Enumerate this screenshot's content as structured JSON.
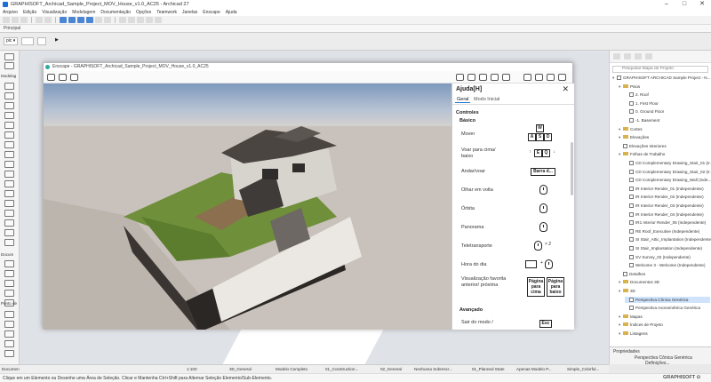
{
  "window": {
    "title": "GRAPHISOFT_Archicad_Sample_Project_MOV_House_v1.0_AC25 - Archicad 27",
    "minimize": "–",
    "maximize": "□",
    "close": "✕"
  },
  "menubar": [
    "Arquivo",
    "Edição",
    "Visualização",
    "Modelagem",
    "Documentação",
    "Opções",
    "Teamwork",
    "Janelas",
    "Enscape",
    "Ajuda"
  ],
  "toolbar": {
    "tab_label": "Principal"
  },
  "infobox": {
    "selector": "pic ▾",
    "arrow": "▶"
  },
  "toolbox": {
    "label_top": "Modelag",
    "label_mid": "Docum",
    "label_bot": "Ponto de"
  },
  "enscape": {
    "title": "Enscape - GRAPHISOFT_Archicad_Sample_Project_MOV_House_v1.0_AC25",
    "help": {
      "title": "Ajuda[H]",
      "close": "✕",
      "tabs": [
        "Geral",
        "Modo Inicial"
      ],
      "section_controls": "Controles",
      "section_basic": "Básico",
      "rows": [
        {
          "label": "Mover",
          "keys": [
            "W",
            "A",
            "S",
            "D"
          ]
        },
        {
          "label": "Voar para cima/ baixo",
          "keys": [
            "↑",
            "E",
            "Q",
            "↓"
          ]
        },
        {
          "label": "Andar/voar",
          "keys": [
            "Barra d..."
          ]
        },
        {
          "label": "Olhar em volta"
        },
        {
          "label": "Órbita"
        },
        {
          "label": "Panorama"
        },
        {
          "label": "Teletransporte",
          "suffix": "× 2"
        },
        {
          "label": "Hora do dia",
          "suffix": "+"
        },
        {
          "label": "Visualização favorita anterior/ próxima",
          "keys": [
            "Página para cima",
            "Página para baixo"
          ]
        }
      ],
      "section_advanced": "Avançado",
      "advanced_row": {
        "label": "Sair do modo /",
        "key": "Esc"
      }
    }
  },
  "navigator": {
    "search_placeholder": "Pesquisar Mapa de Projeto",
    "tree": [
      {
        "label": "GRAPHISOFT ARCHICAD Sample Project - N...",
        "level": 0,
        "type": "root"
      },
      {
        "label": "Pisos",
        "level": 1,
        "type": "folder"
      },
      {
        "label": "2. Roof",
        "level": 2,
        "type": "item"
      },
      {
        "label": "1. First Floor",
        "level": 2,
        "type": "item"
      },
      {
        "label": "0. Ground Floor",
        "level": 2,
        "type": "item"
      },
      {
        "label": "-1. Basement",
        "level": 2,
        "type": "item"
      },
      {
        "label": "Cortes",
        "level": 1,
        "type": "folder"
      },
      {
        "label": "Elevações",
        "level": 1,
        "type": "folder"
      },
      {
        "label": "Elevações Interiores",
        "level": 1,
        "type": "item"
      },
      {
        "label": "Folhas de Trabalho",
        "level": 1,
        "type": "folder"
      },
      {
        "label": "CD Complementary Drawing_Stair_01 (Ir...",
        "level": 2,
        "type": "item"
      },
      {
        "label": "CD Complementary Drawing_Stair_02 (Ir...",
        "level": 2,
        "type": "item"
      },
      {
        "label": "CD Complementary Drawing_Wall (Inde...",
        "level": 2,
        "type": "item"
      },
      {
        "label": "IR Interior Render_01 (Independente)",
        "level": 2,
        "type": "item"
      },
      {
        "label": "IR Interior Render_02 (Independente)",
        "level": 2,
        "type": "item"
      },
      {
        "label": "IR Interior Render_03 (Independente)",
        "level": 2,
        "type": "item"
      },
      {
        "label": "IR Interior Render_04 (Independente)",
        "level": 2,
        "type": "item"
      },
      {
        "label": "IR1 Interior Render_05 (Independente)",
        "level": 2,
        "type": "item"
      },
      {
        "label": "RE Roof_Executive (Independente)",
        "level": 2,
        "type": "item"
      },
      {
        "label": "SI Stair_Attic_Implantation (Independente)",
        "level": 2,
        "type": "item"
      },
      {
        "label": "SI Stair_Implantation (Independente)",
        "level": 2,
        "type": "item"
      },
      {
        "label": "SV Survey_02 (Independente)",
        "level": 2,
        "type": "item"
      },
      {
        "label": "Welcome 3 - Welcome (Independente)",
        "level": 2,
        "type": "item"
      },
      {
        "label": "Detalhes",
        "level": 1,
        "type": "item"
      },
      {
        "label": "Documentos 3D",
        "level": 1,
        "type": "folder"
      },
      {
        "label": "3D",
        "level": 1,
        "type": "folder"
      },
      {
        "label": "Perspectiva Cônica Genérica",
        "level": 2,
        "type": "item",
        "selected": true
      },
      {
        "label": "Perspectiva Axonométrica Genérica",
        "level": 2,
        "type": "item"
      },
      {
        "label": "Mapas",
        "level": 1,
        "type": "folder"
      },
      {
        "label": "Índices de Projeto",
        "level": 1,
        "type": "folder"
      },
      {
        "label": "Listagens",
        "level": 1,
        "type": "folder"
      }
    ],
    "properties_title": "Propriedades",
    "properties_value": "Perspectiva Cônica Genérica",
    "properties_button": "Definições..."
  },
  "statusbar": {
    "items": [
      "Documen",
      "1:100",
      "3D_General",
      "Modelo Completo",
      "01_Construction...",
      "02_General",
      "Nenhuma Sobrescr...",
      "01_Planned State",
      "Apenas Modelo P...",
      "Simple_Colorful..."
    ],
    "message": "Clique em um Elemento ou Desenhe uma Área de Seleção. Clicar e Mantenha Ctrl+Shift para Alternar Seleção Elemento/Sub-Elemento.",
    "brand": "GRAPHISOFT",
    "brand_mark": "⊙"
  }
}
